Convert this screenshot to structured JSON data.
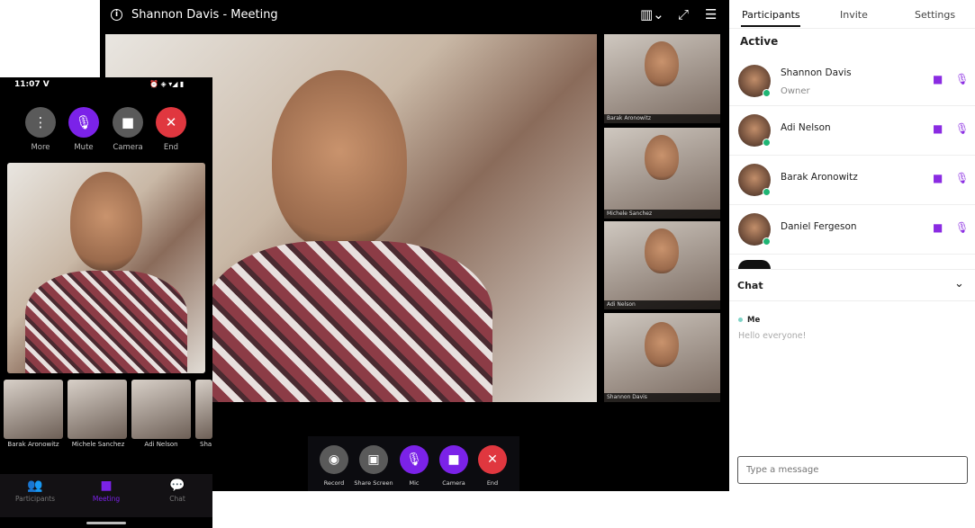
{
  "desktop": {
    "title": "Shannon Davis - Meeting",
    "icons": [
      "info-icon",
      "layout-icon",
      "expand-icon",
      "menu-icon"
    ],
    "thumbnails": [
      "Barak Aronowitz",
      "Michele Sanchez",
      "Adi Nelson",
      "Shannon Davis"
    ],
    "controls": [
      {
        "label": "Record",
        "icon": "record-icon",
        "color": "#5a5a5a"
      },
      {
        "label": "Share Screen",
        "icon": "share-screen-icon",
        "color": "#5a5a5a"
      },
      {
        "label": "Mic",
        "icon": "mic-icon",
        "color": "#7b22e8"
      },
      {
        "label": "Camera",
        "icon": "camera-icon",
        "color": "#7b22e8"
      },
      {
        "label": "End",
        "icon": "close-icon",
        "color": "#e0373f"
      }
    ]
  },
  "phone": {
    "time": "11:07",
    "carrier": "V",
    "buttons": [
      {
        "label": "More",
        "icon": "more-icon"
      },
      {
        "label": "Mute",
        "icon": "mic-icon"
      },
      {
        "label": "Camera",
        "icon": "camera-icon"
      },
      {
        "label": "End",
        "icon": "close-icon"
      }
    ],
    "thumbnails": [
      "Barak Aronowitz",
      "Michele Sanchez",
      "Adi Nelson",
      "Sha"
    ],
    "nav": [
      {
        "label": "Participants",
        "active": false
      },
      {
        "label": "Meeting",
        "active": true
      },
      {
        "label": "Chat",
        "active": false
      }
    ]
  },
  "panel": {
    "tabs": [
      "Participants",
      "Invite",
      "Settings"
    ],
    "active_tab": "Participants",
    "section": "Active",
    "participants": [
      {
        "name": "Shannon Davis",
        "role": "Owner"
      },
      {
        "name": "Adi Nelson"
      },
      {
        "name": "Barak Aronowitz"
      },
      {
        "name": "Daniel Fergeson"
      }
    ],
    "chat": {
      "title": "Chat",
      "messages": [
        {
          "sender": "Me",
          "text": "Hello everyone!"
        }
      ],
      "placeholder": "Type a message"
    }
  },
  "colors": {
    "accent": "#7b22e8",
    "end": "#e0373f",
    "online": "#1fb574"
  }
}
